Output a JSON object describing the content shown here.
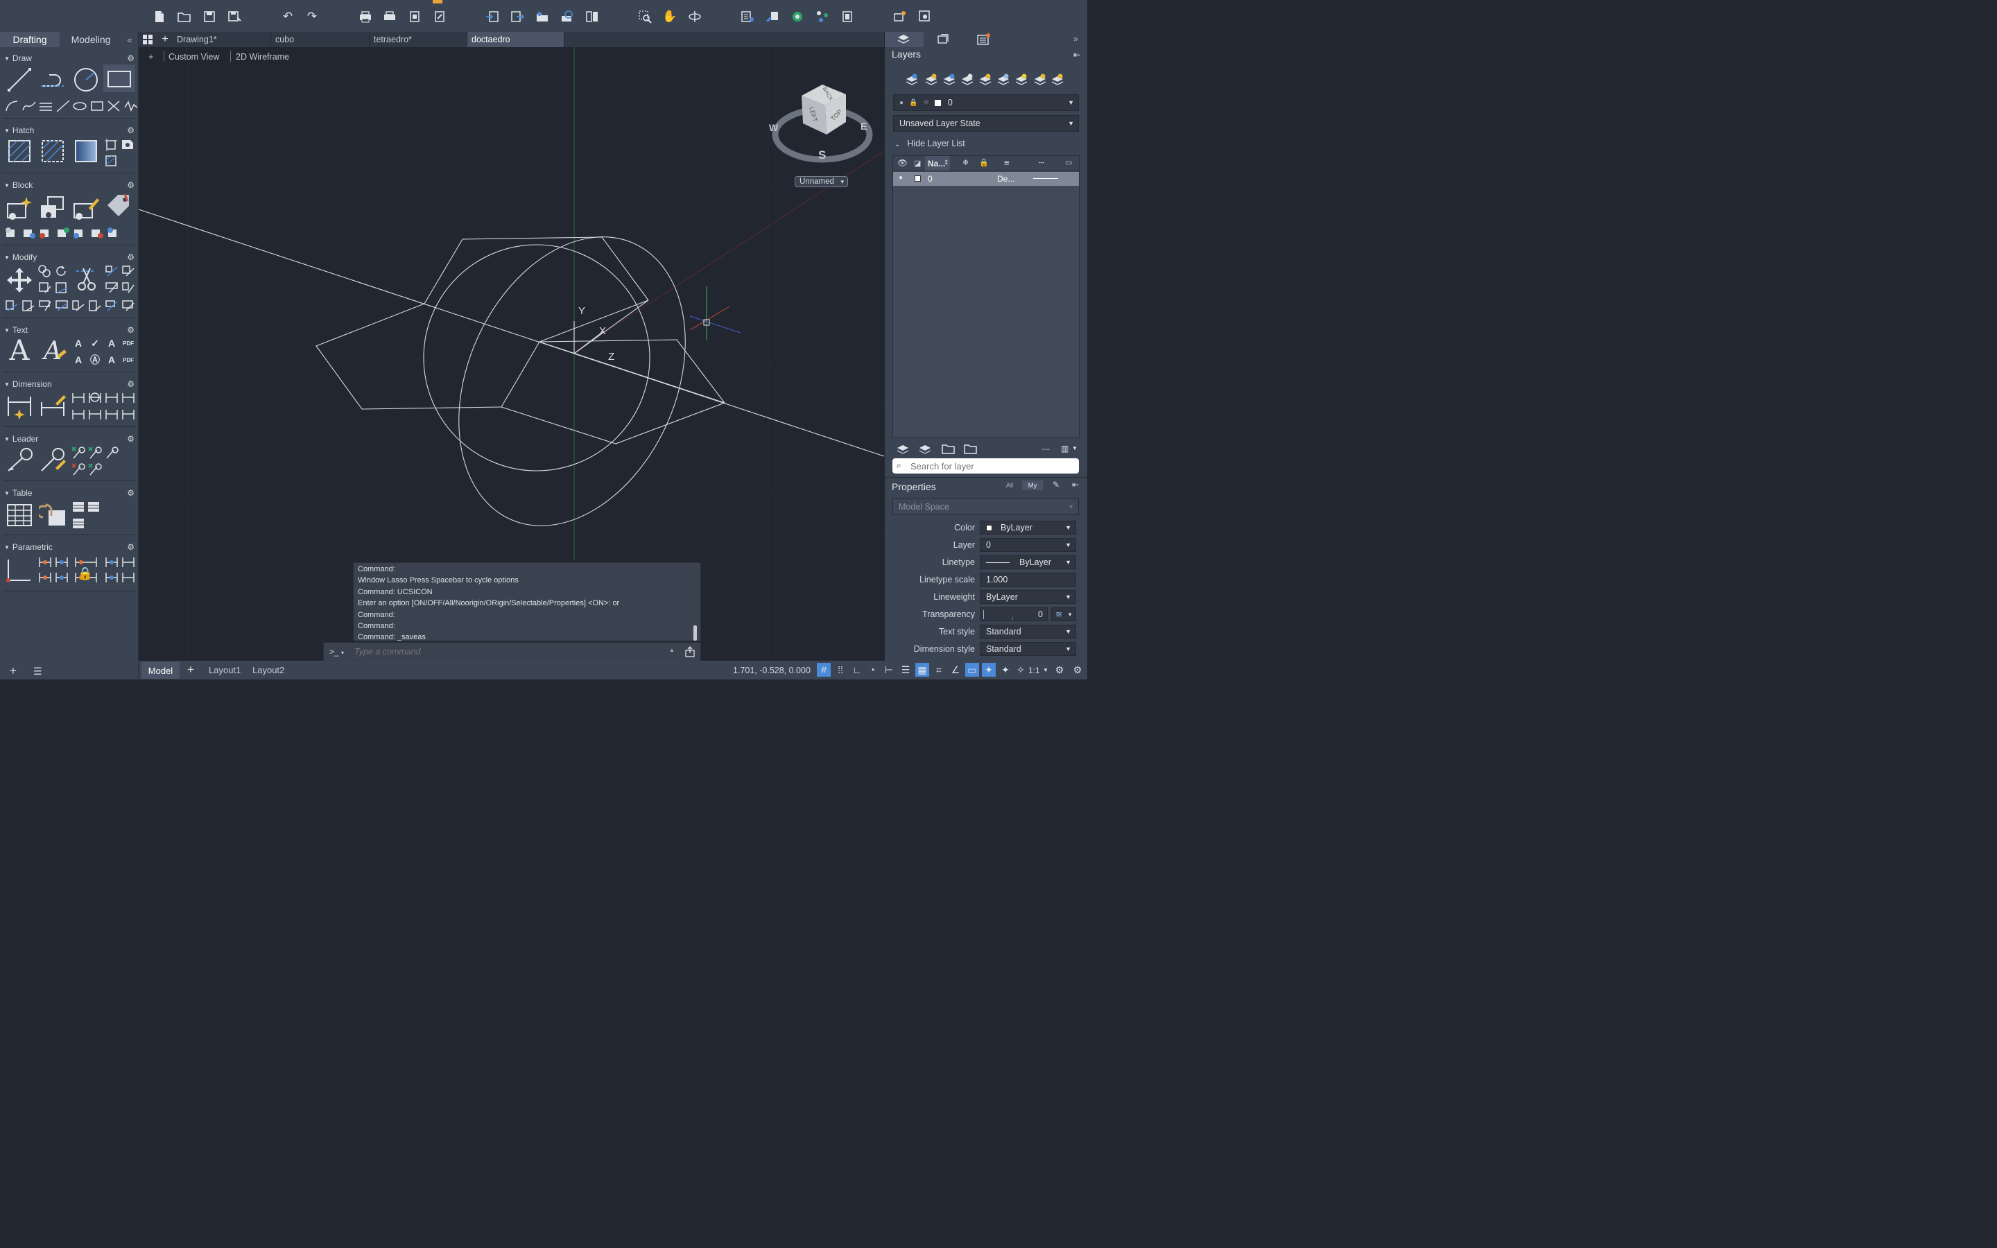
{
  "toolbar": {
    "icons": [
      "new-file-icon",
      "open-file-icon",
      "save-icon",
      "save-as-icon",
      "undo-icon",
      "redo-icon",
      "plot-icon",
      "batch-plot-icon",
      "page-setup-icon",
      "publish-icon",
      "import-icon",
      "export-icon",
      "attach-icon",
      "share-icon",
      "sheet-icon",
      "zoom-window-icon",
      "pan-icon",
      "orbit-icon",
      "properties-icon",
      "match-properties-icon",
      "render-icon",
      "layer-icon",
      "view-icon",
      "camera-icon",
      "settings-icon"
    ]
  },
  "left_panel": {
    "tabs": [
      "Drafting",
      "Modeling"
    ],
    "collapse_glyph": "«",
    "sections": [
      "Draw",
      "Hatch",
      "Block",
      "Modify",
      "Text",
      "Dimension",
      "Leader",
      "Table",
      "Parametric"
    ]
  },
  "file_tabs": {
    "items": [
      "Drawing1*",
      "cubo",
      "tetraedro*",
      "doctaedro"
    ],
    "active": "doctaedro"
  },
  "viewport": {
    "plus": "+",
    "view_label": "Custom View",
    "visual_style": "2D Wireframe",
    "viewcube": {
      "faces": [
        "BACK",
        "LEFT",
        "TOP"
      ],
      "compass": {
        "w": "W",
        "e": "E",
        "s": "S"
      },
      "ucs_menu": "Unnamed"
    },
    "axes": {
      "y": "Y",
      "x": "X",
      "z": "Z"
    }
  },
  "command": {
    "history": [
      "Command:",
      "Window Lasso  Press Spacebar to cycle options",
      "Command: UCSICON",
      "Enter an option [ON/OFF/All/Noorigin/ORigin/Selectable/Properties] <ON>: or",
      "Command:",
      "Command:",
      "Command: _saveas"
    ],
    "prompt": ">_",
    "placeholder": "Type a command"
  },
  "layers_panel": {
    "title": "Layers",
    "current_layer": "0",
    "layer_state": "Unsaved Layer State",
    "hide_list": "Hide Layer List",
    "columns": {
      "name": "Na..."
    },
    "rows": [
      {
        "name": "0",
        "description": "De..."
      }
    ],
    "search_placeholder": "Search for layer"
  },
  "properties_panel": {
    "title": "Properties",
    "filters": [
      "All",
      "My"
    ],
    "space": "Model Space",
    "rows": [
      {
        "label": "Color",
        "value": "ByLayer"
      },
      {
        "label": "Layer",
        "value": "0"
      },
      {
        "label": "Linetype",
        "value": "ByLayer"
      },
      {
        "label": "Linetype scale",
        "value": "1.000"
      },
      {
        "label": "Lineweight",
        "value": "ByLayer"
      },
      {
        "label": "Transparency",
        "value": "0"
      },
      {
        "label": "Text style",
        "value": "Standard"
      },
      {
        "label": "Dimension style",
        "value": "Standard"
      }
    ]
  },
  "status_bar": {
    "layout_tabs": [
      "Model",
      "Layout1",
      "Layout2"
    ],
    "active": "Model",
    "coordinates": "1.701, -0.528, 0.000",
    "scale": "1:1"
  },
  "colors": {
    "panel": "#3b4453",
    "canvas": "#212630",
    "accent": "#4a8ad8",
    "notification": "#e8743b"
  }
}
